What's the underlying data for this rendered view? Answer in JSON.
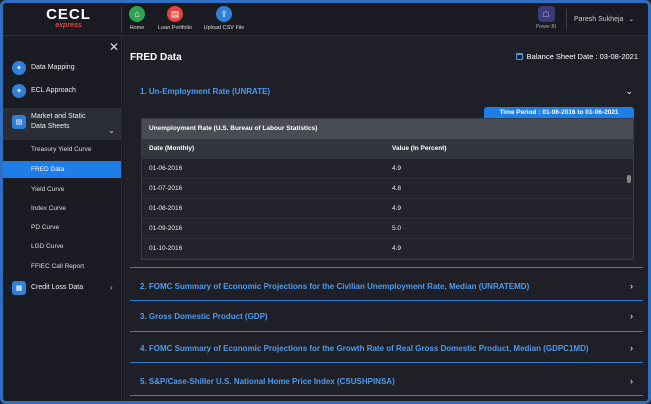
{
  "app": {
    "logo_main": "CECL",
    "logo_sub": "express"
  },
  "nav": [
    {
      "label": "Home",
      "color": "#2ea44f",
      "glyph": "⌂"
    },
    {
      "label": "Loan Portfolio",
      "color": "#e2453c",
      "glyph": "▤"
    },
    {
      "label": "Upload CSV File",
      "color": "#2f80d9",
      "glyph": "⇪"
    }
  ],
  "powerbi": {
    "label": "Power BI"
  },
  "user": {
    "name": "Paresh Sukheja",
    "caret": "⌄"
  },
  "sidebar": {
    "close": "✕",
    "items": [
      {
        "label": "Data Mapping"
      },
      {
        "label": "ECL Approach"
      },
      {
        "label": "Market and Static Data Sheets"
      },
      {
        "label": "Credit Loss Data"
      }
    ],
    "subitems": [
      "Treasury Yield Curve",
      "FRED Data",
      "Yield Curve",
      "Index Curve",
      "PD Curve",
      "LGD Curve",
      "FFIEC Call Report"
    ],
    "active_sub": "FRED Data"
  },
  "main": {
    "title": "FRED Data",
    "balance_sheet_date": "Balance Sheet Date : 03-08-2021",
    "time_period": "Time Period : 01-06-2016 to 01-06-2021",
    "sections": [
      "1. Un-Employment Rate (UNRATE)",
      "2. FOMC Summary of Economic Projections for the Civilian Unemployment Rate, Median (UNRATEMD)",
      "3. Gross Domestic Product (GDP)",
      "4. FOMC Summary of Economic Projections for the Growth Rate of Real Gross Domestic Product, Median (GDPC1MD)",
      "5. S&P/Case-Shiller U.S. National Home Price Index (CSUSHPINSA)"
    ],
    "table": {
      "caption": "Unemployment Rate (U.S. Bureau of Labour Statistics)",
      "headers": [
        "Date (Monthly)",
        "Value (In Percent)"
      ],
      "rows": [
        [
          "01-06-2016",
          "4.9"
        ],
        [
          "01-07-2016",
          "4.8"
        ],
        [
          "01-08-2016",
          "4.9"
        ],
        [
          "01-09-2016",
          "5.0"
        ],
        [
          "01-10-2016",
          "4.9"
        ]
      ]
    }
  }
}
